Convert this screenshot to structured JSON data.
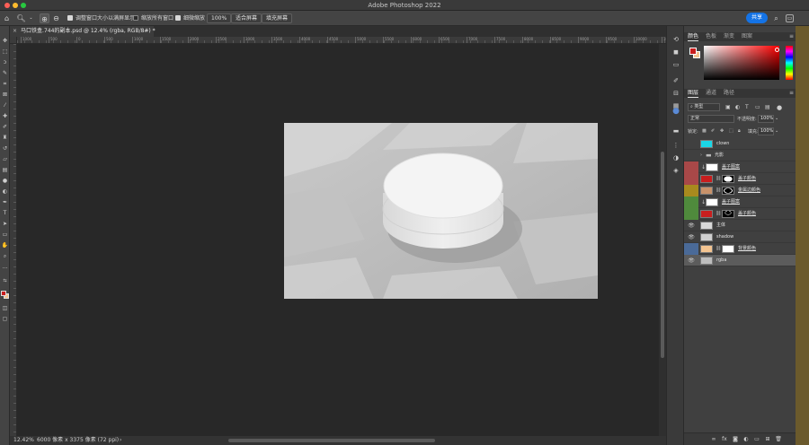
{
  "app": {
    "title": "Adobe Photoshop 2022"
  },
  "options_bar": {
    "resize_windows_label": "调整窗口大小以满屏显示",
    "zoom_all_windows_label": "缩放所有窗口",
    "scrubby_zoom_label": "细微缩放",
    "zoom_percent": "100%",
    "fit_screen_label": "适合屏幕",
    "fill_screen_label": "填充屏幕",
    "share_label": "共享"
  },
  "document": {
    "tab_title": "马口铁盒.744的副本.psd @ 12.4% (rgba, RGB/8#) *",
    "close_glyph": "×"
  },
  "ruler": {
    "labels": [
      "1000",
      "500",
      "0",
      "500",
      "1000",
      "1500",
      "2000",
      "2500",
      "3000",
      "3500",
      "4000",
      "4500",
      "5000",
      "5500",
      "6000",
      "6500",
      "7000",
      "7500",
      "8000",
      "8500",
      "9000",
      "9500",
      "10000",
      "10500"
    ]
  },
  "status": {
    "zoom": "12.42%",
    "info": "6000 像素 x 3375 像素 (72 ppi)"
  },
  "color_panel": {
    "tabs": [
      "颜色",
      "色板",
      "渐变",
      "图案"
    ],
    "foreground": "#c81e1e",
    "background": "#f3c491"
  },
  "layers_panel": {
    "tabs": [
      "图层",
      "通道",
      "路径"
    ],
    "filter_kind": "类型",
    "blend_mode": "正常",
    "opacity_label": "不透明度:",
    "opacity_value": "100%",
    "lock_label": "锁定:",
    "fill_label": "填充:",
    "fill_value": "100%",
    "layers": [
      {
        "name": "clown",
        "visible": false,
        "label_color": "",
        "thumb_color": "#1ad6e6",
        "kind": "pixel"
      },
      {
        "name": "光影",
        "visible": false,
        "label_color": "",
        "thumb_color": "",
        "kind": "group"
      },
      {
        "name": "盖子图案",
        "visible": false,
        "label_color": "#a84848",
        "thumb_color": "#ffffff",
        "kind": "smart",
        "clip": true
      },
      {
        "name": "盖子颜色",
        "visible": false,
        "label_color": "#a84848",
        "thumb_color": "#c81e1e",
        "kind": "fill_mask",
        "mask": "oval"
      },
      {
        "name": "金属边颜色",
        "visible": false,
        "label_color": "#a88a1e",
        "thumb_color": "#c8926a",
        "kind": "fill_mask",
        "mask": "ring"
      },
      {
        "name": "盖子图案",
        "visible": false,
        "label_color": "#4f8a3c",
        "thumb_color": "#ffffff",
        "kind": "smart",
        "clip": true
      },
      {
        "name": "盖子颜色",
        "visible": false,
        "label_color": "#4f8a3c",
        "thumb_color": "#c81e1e",
        "kind": "fill_mask",
        "mask": "arc"
      },
      {
        "name": "主体",
        "visible": true,
        "label_color": "",
        "thumb_color": "#d9d9d9",
        "kind": "pixel"
      },
      {
        "name": "shadow",
        "visible": true,
        "label_color": "",
        "thumb_color": "#d0d0d0",
        "kind": "pixel"
      },
      {
        "name": "背景颜色",
        "visible": false,
        "label_color": "#4a6a98",
        "thumb_color": "#f3c491",
        "kind": "fill_mask",
        "mask": "white"
      },
      {
        "name": "rgba",
        "visible": true,
        "label_color": "",
        "thumb_color": "#bdbdbd",
        "kind": "pixel",
        "selected": true
      }
    ]
  },
  "icons": {
    "home": "home-icon",
    "zoom": "zoom-tool-icon",
    "search": "search-icon",
    "workspace": "workspace-icon",
    "eye": "eye-icon",
    "folder": "folder-icon",
    "link": "link-icon"
  }
}
